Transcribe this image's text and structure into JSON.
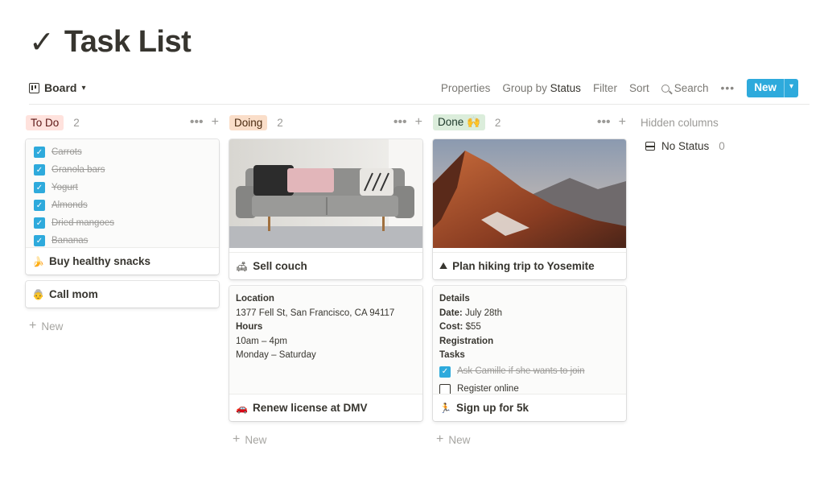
{
  "page": {
    "check_glyph": "✓",
    "title": "Task List"
  },
  "toolbar": {
    "view_label": "Board",
    "properties": "Properties",
    "group_by_prefix": "Group by",
    "group_by_value": "Status",
    "filter": "Filter",
    "sort": "Sort",
    "search": "Search",
    "more": "•••",
    "new_label": "New",
    "new_arrow": "▾"
  },
  "columns": [
    {
      "name": "To Do",
      "count": "2",
      "pill_bg": "#ffe2dd",
      "pill_color": "#5d1715",
      "cards": [
        {
          "emoji": "🍌",
          "title": "Buy healthy snacks",
          "checklist": [
            "Carrots",
            "Granola bars",
            "Yogurt",
            "Almonds",
            "Dried mangoes",
            "Bananas"
          ]
        },
        {
          "emoji": "👵",
          "title": "Call mom"
        }
      ],
      "new_label": "New"
    },
    {
      "name": "Doing",
      "count": "2",
      "pill_bg": "#fadec9",
      "pill_color": "#49290e",
      "cards": [
        {
          "emoji": "🛋",
          "title": "Sell couch",
          "image": "couch-photo"
        },
        {
          "emoji": "🚗",
          "title": "Renew license at DMV",
          "details": {
            "h1": "Location",
            "address": "1377 Fell St, San Francisco, CA 94117",
            "h2": "Hours",
            "time": "10am – 4pm",
            "days": "Monday – Saturday"
          }
        }
      ],
      "new_label": "New"
    },
    {
      "name": "Done 🙌",
      "count": "2",
      "pill_bg": "#dbeddb",
      "pill_color": "#1c3829",
      "cards": [
        {
          "emoji": "⛰",
          "title": "Plan hiking trip to Yosemite",
          "image": "mountain-photo"
        },
        {
          "emoji": "🏃",
          "title": "Sign up for 5k",
          "details": {
            "h1": "Details",
            "date_label": "Date:",
            "date": "July 28th",
            "cost_label": "Cost:",
            "cost": "$55",
            "h2": "Registration",
            "h3": "Tasks",
            "tasks": [
              {
                "label": "Ask Camille if she wants to join",
                "done": true
              },
              {
                "label": "Register online",
                "done": false
              }
            ]
          }
        }
      ],
      "new_label": "New"
    }
  ],
  "hidden": {
    "label": "Hidden columns",
    "no_status": "No Status",
    "no_status_count": "0"
  },
  "colors": {
    "accent": "#2eaadc",
    "text": "#37352f",
    "muted": "#9b9a97"
  }
}
